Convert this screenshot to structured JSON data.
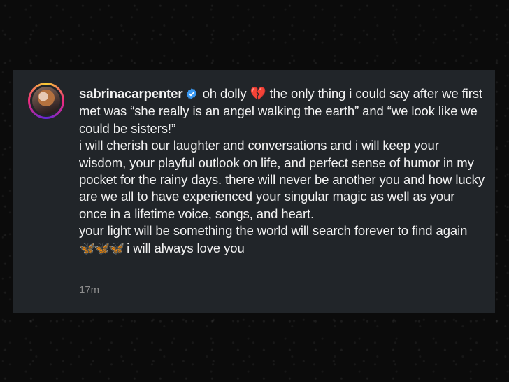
{
  "post": {
    "username": "sabrinacarpenter",
    "line1_a": "oh dolly",
    "broken_heart_emoji": "💔",
    "line1_b": "the only thing i could say after we first met was “she really is an angel walking the earth” and “we look like we could be sisters!”",
    "line2": "i will cherish our laughter and conversations and i will keep your wisdom, your playful outlook on life, and perfect sense of humor in my pocket for the rainy days. there will never be another you and how lucky are we all to have experienced your singular magic as well as your once in a lifetime voice, songs, and heart.",
    "line3_a": "your light will be something the world will search forever to find again",
    "butterfly_emojis": "🦋🦋🦋",
    "line3_b": "i will always love you",
    "timestamp": "17m"
  },
  "colors": {
    "card_background": "#212529",
    "verified_badge": "#3897f0",
    "timestamp": "#8e8e8e"
  },
  "icons": {
    "avatar": "profile-picture",
    "verified": "verified-badge-icon"
  }
}
